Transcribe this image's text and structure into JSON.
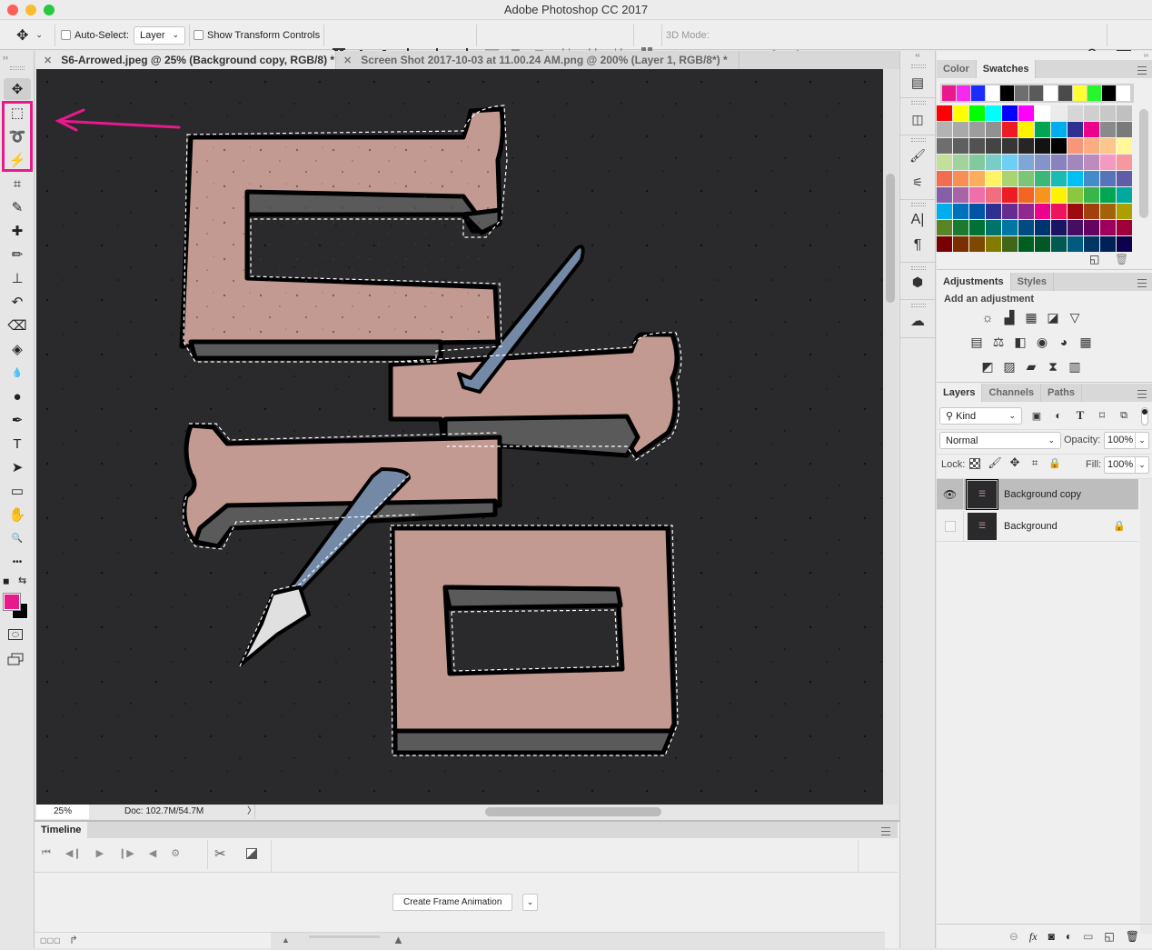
{
  "app": {
    "title": "Adobe Photoshop CC 2017"
  },
  "options_bar": {
    "auto_select_label": "Auto-Select:",
    "auto_select_checked": false,
    "auto_select_target": "Layer",
    "show_transform_label": "Show Transform Controls",
    "show_transform_checked": false,
    "mode_3d_label": "3D Mode:",
    "align_icons": [
      "align-top-edges",
      "align-vertical-centers",
      "align-bottom-edges",
      "align-left-edges",
      "align-horizontal-centers",
      "align-right-edges"
    ],
    "distribute_icons": [
      "distribute-top",
      "distribute-vcenter",
      "distribute-bottom",
      "distribute-left",
      "distribute-hcenter",
      "distribute-right",
      "auto-align-layers"
    ],
    "mode_3d_icons": [
      "orbit-3d",
      "roll-3d",
      "pan-3d",
      "slide-3d",
      "scale-3d"
    ]
  },
  "document_tabs": [
    {
      "label": "S6-Arrowed.jpeg @ 25% (Background copy, RGB/8) *",
      "active": true
    },
    {
      "label": "Screen Shot 2017-10-03 at 11.00.24 AM.png @ 200% (Layer 1, RGB/8*) *",
      "active": false
    }
  ],
  "tools": [
    {
      "name": "move-tool",
      "glyph": "✥"
    },
    {
      "name": "rectangular-marquee-tool",
      "glyph": "⬚"
    },
    {
      "name": "magnetic-lasso-tool",
      "glyph": "➰"
    },
    {
      "name": "magic-wand-tool",
      "glyph": "⚡"
    },
    {
      "name": "crop-tool",
      "glyph": "⌗"
    },
    {
      "name": "eyedropper-tool",
      "glyph": "✎"
    },
    {
      "name": "healing-brush-tool",
      "glyph": "✚"
    },
    {
      "name": "brush-tool",
      "glyph": "✏"
    },
    {
      "name": "clone-stamp-tool",
      "glyph": "⊥"
    },
    {
      "name": "history-brush-tool",
      "glyph": "↶"
    },
    {
      "name": "eraser-tool",
      "glyph": "⌫"
    },
    {
      "name": "paint-bucket-tool",
      "glyph": "◈"
    },
    {
      "name": "blur-tool",
      "glyph": "💧"
    },
    {
      "name": "dodge-tool",
      "glyph": "●"
    },
    {
      "name": "pen-tool",
      "glyph": "✒"
    },
    {
      "name": "type-tool",
      "glyph": "T"
    },
    {
      "name": "path-selection-tool",
      "glyph": "➤"
    },
    {
      "name": "rectangle-tool",
      "glyph": "▭"
    },
    {
      "name": "hand-tool",
      "glyph": "✋"
    },
    {
      "name": "zoom-tool",
      "glyph": "🔍"
    },
    {
      "name": "edit-toolbar",
      "glyph": "•••"
    }
  ],
  "colors": {
    "foreground": "#e8198b",
    "background": "#000000",
    "highlight": "#e8198b",
    "canvas": "#2a2a2d",
    "letter": "#c29a92",
    "shadow": "#5a5a5a",
    "pen": "#7489a6"
  },
  "status": {
    "zoom": "25%",
    "doc": "Doc: 102.7M/54.7M"
  },
  "timeline": {
    "title": "Timeline",
    "create_button": "Create Frame Animation"
  },
  "color_panel": {
    "tabs": [
      "Color",
      "Swatches"
    ],
    "active": "Swatches"
  },
  "swatches": {
    "recent": [
      "#e8198b",
      "#f52af0",
      "#1a2cff",
      "#ffffff",
      "#000000",
      "#6e6e6e",
      "#5a5a5a",
      "#ffffff",
      "#4a4a4a",
      "#ffff33",
      "#27f52e",
      "#000000",
      "#ffffff"
    ],
    "grid": [
      [
        "#ff0000",
        "#ffff00",
        "#00ff00",
        "#00ffff",
        "#0000ff",
        "#ff00ff",
        "#ffffff",
        "#ebebeb",
        "#d6d6d6",
        "#cfcfcf",
        "#c8c8c8",
        "#c0c0c0"
      ],
      [
        "#b3b3b3",
        "#a9a9a9",
        "#9d9d9d",
        "#919191",
        "#ed1c24",
        "#fff200",
        "#00a651",
        "#00aeef",
        "#2e3192",
        "#ec008c",
        "#8a8a8a",
        "#7a7a7a"
      ],
      [
        "#6e6e6e",
        "#5f5f5f",
        "#525252",
        "#444444",
        "#363636",
        "#262626",
        "#131313",
        "#000000",
        "#f7977a",
        "#f9ad81",
        "#fdc68a",
        "#fff79a"
      ],
      [
        "#c4df9b",
        "#a3d39c",
        "#82ca9d",
        "#7accc8",
        "#6dcff6",
        "#7ea7d8",
        "#8493ca",
        "#8882be",
        "#a187be",
        "#bc8cbf",
        "#f49ac2",
        "#f6989d"
      ],
      [
        "#f26c4f",
        "#f68e56",
        "#fbaf5d",
        "#fff467",
        "#acd372",
        "#7cc576",
        "#3bb878",
        "#1abbb4",
        "#00bff3",
        "#438ccb",
        "#5574b9",
        "#605ca8"
      ],
      [
        "#8560a8",
        "#a864a8",
        "#f06eaa",
        "#f26d7d",
        "#ed1c24",
        "#f26522",
        "#f7941d",
        "#fff200",
        "#8dc73f",
        "#39b54a",
        "#00a651",
        "#00a99d"
      ],
      [
        "#00aeef",
        "#0072bc",
        "#0054a6",
        "#2e3192",
        "#662d91",
        "#92278f",
        "#ec008c",
        "#ed145b",
        "#9e0b0f",
        "#a0410d",
        "#a36209",
        "#aba000"
      ],
      [
        "#598527",
        "#1a7b30",
        "#007236",
        "#00746b",
        "#0076a3",
        "#004b80",
        "#003471",
        "#1b1464",
        "#440e62",
        "#630460",
        "#9e005d",
        "#9e0039"
      ],
      [
        "#790000",
        "#7b2e00",
        "#7d4900",
        "#827b00",
        "#406618",
        "#005e20",
        "#005826",
        "#005952",
        "#005b7f",
        "#003663",
        "#002157",
        "#0d004c"
      ]
    ]
  },
  "adjustments": {
    "tabs": [
      "Adjustments",
      "Styles"
    ],
    "active": "Adjustments",
    "heading": "Add an adjustment",
    "rows": [
      [
        "brightness-contrast",
        "levels",
        "curves",
        "exposure",
        "vibrance"
      ],
      [
        "hue-saturation",
        "color-balance",
        "black-white",
        "photo-filter",
        "channel-mixer",
        "color-lookup"
      ],
      [
        "invert",
        "posterize",
        "threshold",
        "selective-color",
        "gradient-map"
      ]
    ]
  },
  "layers_panel": {
    "tabs": [
      "Layers",
      "Channels",
      "Paths"
    ],
    "active": "Layers",
    "filter_kind": "Kind",
    "blend_mode": "Normal",
    "opacity_label": "Opacity:",
    "opacity": "100%",
    "lock_label": "Lock:",
    "fill_label": "Fill:",
    "fill": "100%",
    "layers": [
      {
        "name": "Background copy",
        "visible": true,
        "selected": true,
        "locked": false
      },
      {
        "name": "Background",
        "visible": false,
        "selected": false,
        "locked": true
      }
    ],
    "footer_icons": [
      "link-layers",
      "add-layer-style",
      "add-mask",
      "new-adjustment-layer",
      "new-group",
      "new-layer",
      "delete-layer"
    ]
  },
  "dock_icons": [
    "history",
    "properties-transform",
    "brush-presets",
    "brush-settings",
    "character",
    "paragraph",
    "3d-panel",
    "creative-cloud-libraries"
  ]
}
